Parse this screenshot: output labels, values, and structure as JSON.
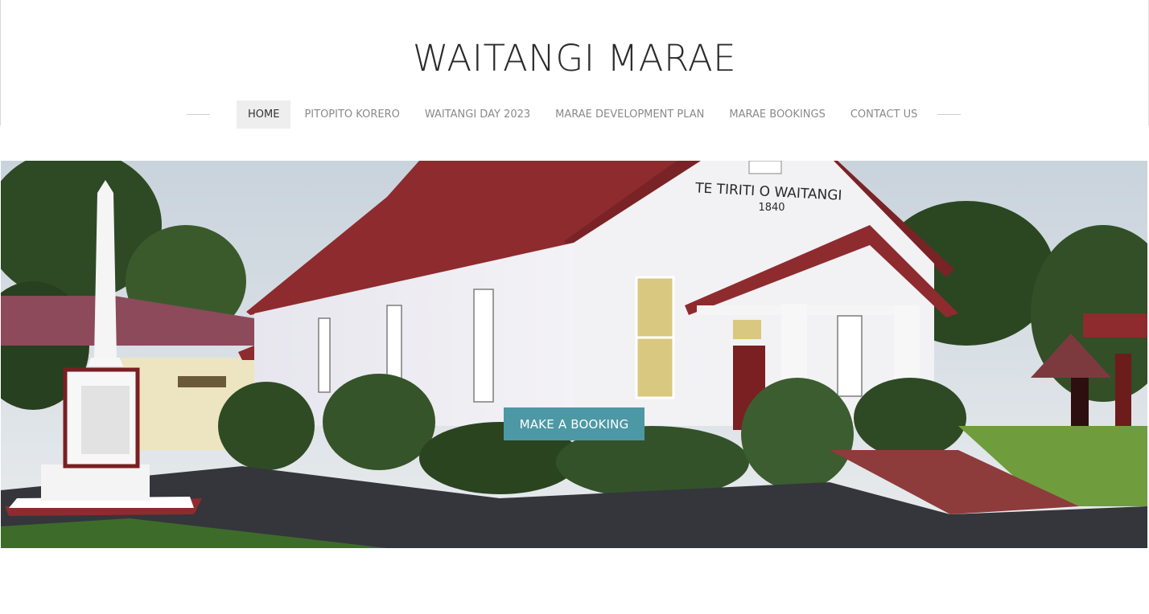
{
  "site": {
    "title": "WAITANGI MARAE"
  },
  "nav": {
    "items": [
      {
        "label": "HOME",
        "active": true
      },
      {
        "label": "PITOPITO KORERO",
        "active": false
      },
      {
        "label": "WAITANGI DAY 2023",
        "active": false
      },
      {
        "label": "MARAE DEVELOPMENT PLAN",
        "active": false
      },
      {
        "label": "MARAE BOOKINGS",
        "active": false
      },
      {
        "label": "CONTACT US",
        "active": false
      }
    ]
  },
  "hero": {
    "sign_line1": "TE TIRITI O WAITANGI",
    "sign_line2": "1840",
    "cta_label": "MAKE A BOOKING"
  },
  "colors": {
    "cta": "#4d98a5",
    "roof": "#8e2b2f",
    "active_nav_bg": "#eeeeee"
  }
}
